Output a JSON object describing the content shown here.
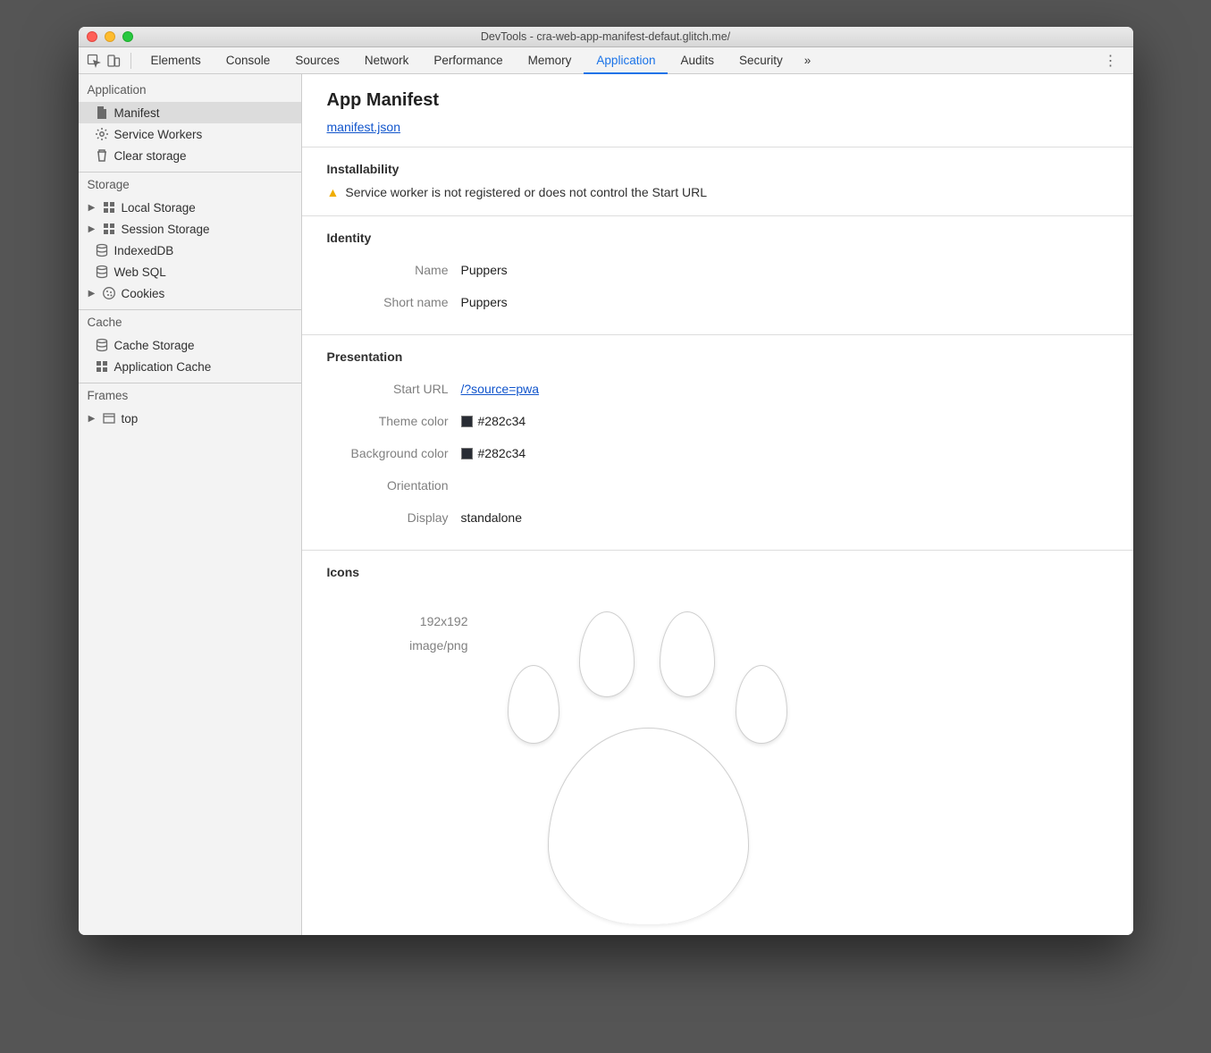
{
  "titlebar": {
    "text": "DevTools - cra-web-app-manifest-defaut.glitch.me/"
  },
  "tabs": {
    "items": [
      "Elements",
      "Console",
      "Sources",
      "Network",
      "Performance",
      "Memory",
      "Application",
      "Audits",
      "Security"
    ],
    "active": "Application",
    "more": "»"
  },
  "sidebar": {
    "sections": {
      "application": {
        "header": "Application",
        "items": [
          {
            "label": "Manifest",
            "icon": "document-icon",
            "selected": true
          },
          {
            "label": "Service Workers",
            "icon": "gear-icon"
          },
          {
            "label": "Clear storage",
            "icon": "trash-icon"
          }
        ]
      },
      "storage": {
        "header": "Storage",
        "items": [
          {
            "label": "Local Storage",
            "icon": "grid-icon",
            "expandable": true
          },
          {
            "label": "Session Storage",
            "icon": "grid-icon",
            "expandable": true
          },
          {
            "label": "IndexedDB",
            "icon": "database-icon"
          },
          {
            "label": "Web SQL",
            "icon": "database-icon"
          },
          {
            "label": "Cookies",
            "icon": "cookie-icon",
            "expandable": true
          }
        ]
      },
      "cache": {
        "header": "Cache",
        "items": [
          {
            "label": "Cache Storage",
            "icon": "database-icon"
          },
          {
            "label": "Application Cache",
            "icon": "grid-icon"
          }
        ]
      },
      "frames": {
        "header": "Frames",
        "items": [
          {
            "label": "top",
            "icon": "frame-icon",
            "expandable": true
          }
        ]
      }
    }
  },
  "main": {
    "title": "App Manifest",
    "manifest_link": "manifest.json",
    "installability": {
      "title": "Installability",
      "warning": "Service worker is not registered or does not control the Start URL"
    },
    "identity": {
      "title": "Identity",
      "name_label": "Name",
      "name_value": "Puppers",
      "short_name_label": "Short name",
      "short_name_value": "Puppers"
    },
    "presentation": {
      "title": "Presentation",
      "start_url_label": "Start URL",
      "start_url_value": "/?source=pwa",
      "theme_color_label": "Theme color",
      "theme_color_value": "#282c34",
      "bg_color_label": "Background color",
      "bg_color_value": "#282c34",
      "orientation_label": "Orientation",
      "orientation_value": "",
      "display_label": "Display",
      "display_value": "standalone"
    },
    "icons": {
      "title": "Icons",
      "size": "192x192",
      "mime": "image/png"
    }
  }
}
